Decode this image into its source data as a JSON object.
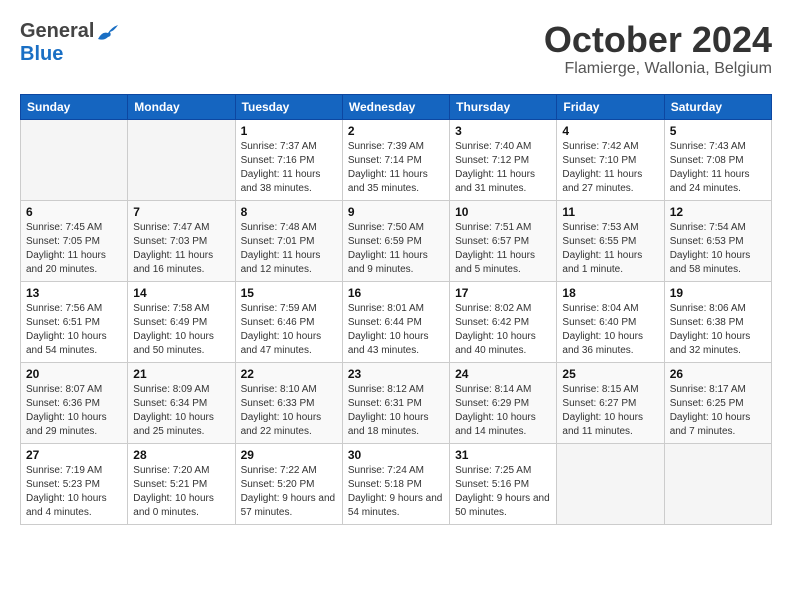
{
  "header": {
    "logo_general": "General",
    "logo_blue": "Blue",
    "month": "October 2024",
    "location": "Flamierge, Wallonia, Belgium"
  },
  "days_of_week": [
    "Sunday",
    "Monday",
    "Tuesday",
    "Wednesday",
    "Thursday",
    "Friday",
    "Saturday"
  ],
  "weeks": [
    [
      {
        "day": "",
        "info": ""
      },
      {
        "day": "",
        "info": ""
      },
      {
        "day": "1",
        "info": "Sunrise: 7:37 AM\nSunset: 7:16 PM\nDaylight: 11 hours and 38 minutes."
      },
      {
        "day": "2",
        "info": "Sunrise: 7:39 AM\nSunset: 7:14 PM\nDaylight: 11 hours and 35 minutes."
      },
      {
        "day": "3",
        "info": "Sunrise: 7:40 AM\nSunset: 7:12 PM\nDaylight: 11 hours and 31 minutes."
      },
      {
        "day": "4",
        "info": "Sunrise: 7:42 AM\nSunset: 7:10 PM\nDaylight: 11 hours and 27 minutes."
      },
      {
        "day": "5",
        "info": "Sunrise: 7:43 AM\nSunset: 7:08 PM\nDaylight: 11 hours and 24 minutes."
      }
    ],
    [
      {
        "day": "6",
        "info": "Sunrise: 7:45 AM\nSunset: 7:05 PM\nDaylight: 11 hours and 20 minutes."
      },
      {
        "day": "7",
        "info": "Sunrise: 7:47 AM\nSunset: 7:03 PM\nDaylight: 11 hours and 16 minutes."
      },
      {
        "day": "8",
        "info": "Sunrise: 7:48 AM\nSunset: 7:01 PM\nDaylight: 11 hours and 12 minutes."
      },
      {
        "day": "9",
        "info": "Sunrise: 7:50 AM\nSunset: 6:59 PM\nDaylight: 11 hours and 9 minutes."
      },
      {
        "day": "10",
        "info": "Sunrise: 7:51 AM\nSunset: 6:57 PM\nDaylight: 11 hours and 5 minutes."
      },
      {
        "day": "11",
        "info": "Sunrise: 7:53 AM\nSunset: 6:55 PM\nDaylight: 11 hours and 1 minute."
      },
      {
        "day": "12",
        "info": "Sunrise: 7:54 AM\nSunset: 6:53 PM\nDaylight: 10 hours and 58 minutes."
      }
    ],
    [
      {
        "day": "13",
        "info": "Sunrise: 7:56 AM\nSunset: 6:51 PM\nDaylight: 10 hours and 54 minutes."
      },
      {
        "day": "14",
        "info": "Sunrise: 7:58 AM\nSunset: 6:49 PM\nDaylight: 10 hours and 50 minutes."
      },
      {
        "day": "15",
        "info": "Sunrise: 7:59 AM\nSunset: 6:46 PM\nDaylight: 10 hours and 47 minutes."
      },
      {
        "day": "16",
        "info": "Sunrise: 8:01 AM\nSunset: 6:44 PM\nDaylight: 10 hours and 43 minutes."
      },
      {
        "day": "17",
        "info": "Sunrise: 8:02 AM\nSunset: 6:42 PM\nDaylight: 10 hours and 40 minutes."
      },
      {
        "day": "18",
        "info": "Sunrise: 8:04 AM\nSunset: 6:40 PM\nDaylight: 10 hours and 36 minutes."
      },
      {
        "day": "19",
        "info": "Sunrise: 8:06 AM\nSunset: 6:38 PM\nDaylight: 10 hours and 32 minutes."
      }
    ],
    [
      {
        "day": "20",
        "info": "Sunrise: 8:07 AM\nSunset: 6:36 PM\nDaylight: 10 hours and 29 minutes."
      },
      {
        "day": "21",
        "info": "Sunrise: 8:09 AM\nSunset: 6:34 PM\nDaylight: 10 hours and 25 minutes."
      },
      {
        "day": "22",
        "info": "Sunrise: 8:10 AM\nSunset: 6:33 PM\nDaylight: 10 hours and 22 minutes."
      },
      {
        "day": "23",
        "info": "Sunrise: 8:12 AM\nSunset: 6:31 PM\nDaylight: 10 hours and 18 minutes."
      },
      {
        "day": "24",
        "info": "Sunrise: 8:14 AM\nSunset: 6:29 PM\nDaylight: 10 hours and 14 minutes."
      },
      {
        "day": "25",
        "info": "Sunrise: 8:15 AM\nSunset: 6:27 PM\nDaylight: 10 hours and 11 minutes."
      },
      {
        "day": "26",
        "info": "Sunrise: 8:17 AM\nSunset: 6:25 PM\nDaylight: 10 hours and 7 minutes."
      }
    ],
    [
      {
        "day": "27",
        "info": "Sunrise: 7:19 AM\nSunset: 5:23 PM\nDaylight: 10 hours and 4 minutes."
      },
      {
        "day": "28",
        "info": "Sunrise: 7:20 AM\nSunset: 5:21 PM\nDaylight: 10 hours and 0 minutes."
      },
      {
        "day": "29",
        "info": "Sunrise: 7:22 AM\nSunset: 5:20 PM\nDaylight: 9 hours and 57 minutes."
      },
      {
        "day": "30",
        "info": "Sunrise: 7:24 AM\nSunset: 5:18 PM\nDaylight: 9 hours and 54 minutes."
      },
      {
        "day": "31",
        "info": "Sunrise: 7:25 AM\nSunset: 5:16 PM\nDaylight: 9 hours and 50 minutes."
      },
      {
        "day": "",
        "info": ""
      },
      {
        "day": "",
        "info": ""
      }
    ]
  ]
}
